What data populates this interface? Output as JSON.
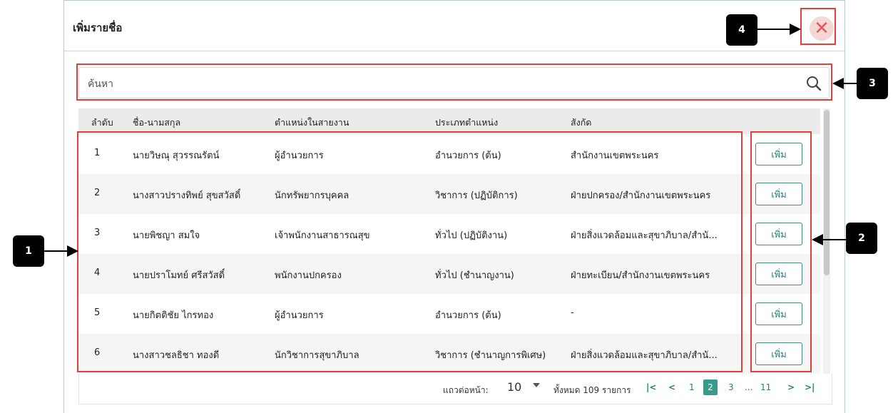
{
  "dialog": {
    "title": "เพิ่มรายชื่อ",
    "close_symbol": "✕"
  },
  "search": {
    "placeholder": "ค้นหา",
    "value": "",
    "icon": "search-icon"
  },
  "table": {
    "headers": [
      "ลำดับ",
      "ชื่อ-นามสกุล",
      "ตำแหน่งในสายงาน",
      "ประเภทตำแหน่ง",
      "สังกัด"
    ],
    "rows": [
      {
        "no": "1",
        "name": "นายวิษณุ สุวรรณรัตน์",
        "position": "ผู้อำนวยการ",
        "type": "อำนวยการ (ต้น)",
        "affiliation": "สำนักงานเขตพระนคร",
        "button": "เพิ่ม"
      },
      {
        "no": "2",
        "name": "นางสาวปรางทิพย์ สุขสวัสดิ์",
        "position": "นักทรัพยากรบุคคล",
        "type": "วิชาการ (ปฏิบัติการ)",
        "affiliation": "ฝ่ายปกครอง/สำนักงานเขตพระนคร",
        "button": "เพิ่ม"
      },
      {
        "no": "3",
        "name": "นายพิชญา สมใจ",
        "position": "เจ้าพนักงานสาธารณสุข",
        "type": "ทั่วไป (ปฏิบัติงาน)",
        "affiliation": "ฝ่ายสิ่งแวดล้อมและสุขาภิบาล/สำนั...",
        "button": "เพิ่ม"
      },
      {
        "no": "4",
        "name": "นายปราโมทย์ ศรีสวัสดิ์",
        "position": "พนักงานปกครอง",
        "type": "ทั่วไป (ชำนาญงาน)",
        "affiliation": "ฝ่ายทะเบียน/สำนักงานเขตพระนคร",
        "button": "เพิ่ม"
      },
      {
        "no": "5",
        "name": "นายกิตติชัย ไกรทอง",
        "position": "ผู้อำนวยการ",
        "type": "อำนวยการ (ต้น)",
        "affiliation": "-",
        "button": "เพิ่ม"
      },
      {
        "no": "6",
        "name": "นางสาวชลธิชา ทองดี",
        "position": "นักวิชาการสุขาภิบาล",
        "type": "วิชาการ (ชำนาญการพิเศษ)",
        "affiliation": "ฝ่ายสิ่งแวดล้อมและสุขาภิบาล/สำนั...",
        "button": "เพิ่ม"
      }
    ]
  },
  "pagination": {
    "rows_per_page_label": "แถวต่อหน้า:",
    "rows_per_page": "10",
    "total_label": "ทั้งหมด 109 รายการ",
    "first": "|<",
    "prev": "<",
    "pages": [
      "1",
      "2",
      "3",
      "...",
      "11"
    ],
    "active_page": "2",
    "next": ">",
    "last": ">|"
  },
  "callouts": [
    "1",
    "2",
    "3",
    "4"
  ],
  "colors": {
    "accent": "#3a9a8c",
    "annotation_red": "#e0403a",
    "close_bg": "#f7d6d6"
  }
}
